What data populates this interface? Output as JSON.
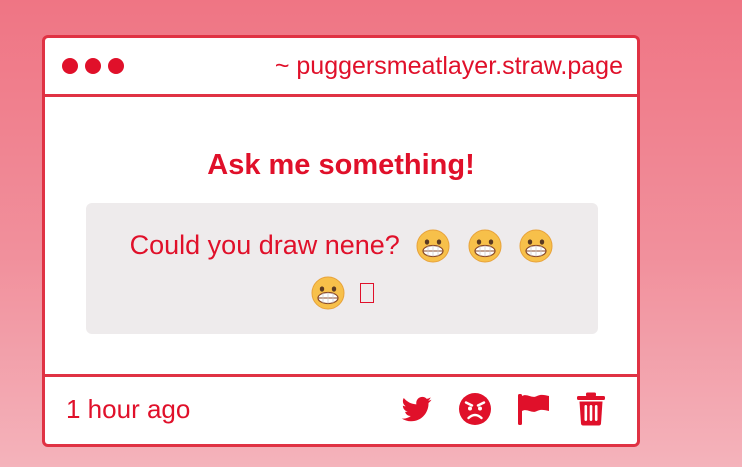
{
  "header": {
    "site_url": "~ puggersmeatlayer.straw.page"
  },
  "body": {
    "heading": "Ask me something!",
    "question": "Could you draw nene?",
    "emojis": [
      "grinning-face-emoji",
      "grinning-face-emoji",
      "grinning-face-emoji",
      "grinning-face-emoji"
    ]
  },
  "footer": {
    "timestamp": "1 hour ago",
    "actions": [
      "twitter-icon",
      "angry-face-icon",
      "flag-icon",
      "trash-icon"
    ]
  },
  "colors": {
    "accent": "#e0102a",
    "border": "#e03244",
    "question_bg": "#eeebec"
  }
}
